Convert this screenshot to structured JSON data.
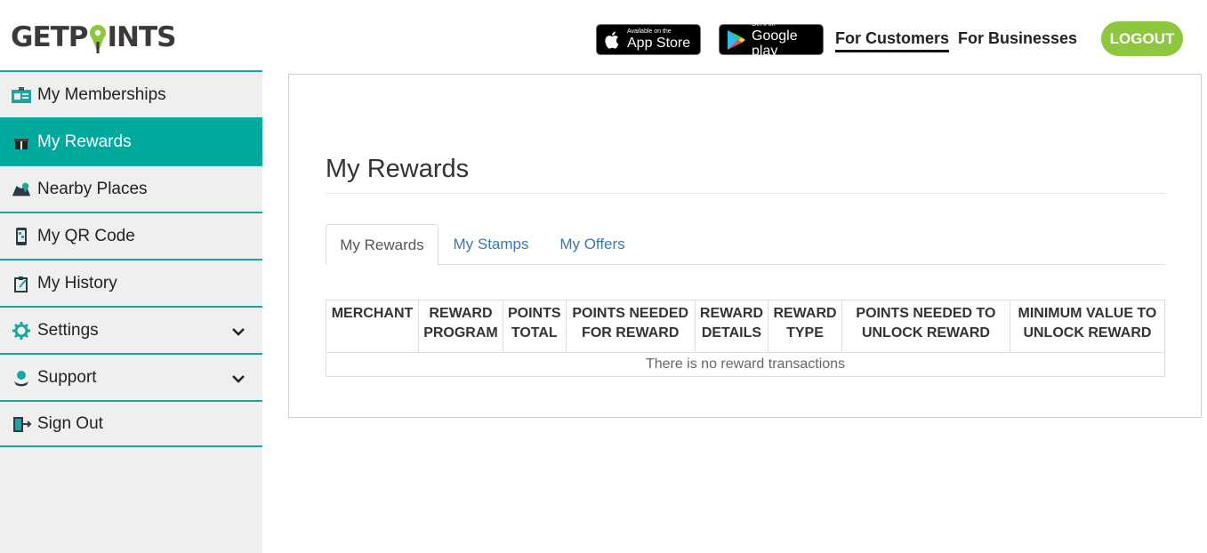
{
  "brand": {
    "logo_text_before": "GETP",
    "logo_text_after": "INTS",
    "logo_pin_color": "#8dc63f"
  },
  "header": {
    "app_store": {
      "small": "Available on the",
      "big": "App Store",
      "icon": "apple-icon"
    },
    "google_play": {
      "small": "Get it on",
      "big": "Google play",
      "icon": "google-play-icon"
    },
    "nav": {
      "customers": "For Customers",
      "businesses": "For Businesses"
    },
    "logout_label": "LOGOUT"
  },
  "colors": {
    "accent": "#00a99d",
    "logout": "#8dc63f",
    "link": "#3a78b4"
  },
  "sidebar": {
    "items": [
      {
        "label": "My Memberships",
        "icon": "membership-card-icon"
      },
      {
        "label": "My Rewards",
        "icon": "gift-icon",
        "active": true
      },
      {
        "label": "Nearby Places",
        "icon": "map-icon"
      },
      {
        "label": "My QR Code",
        "icon": "phone-qr-icon"
      },
      {
        "label": "My History",
        "icon": "clipboard-history-icon"
      },
      {
        "label": "Settings",
        "icon": "gear-icon",
        "expandable": true
      },
      {
        "label": "Support",
        "icon": "support-icon",
        "expandable": true
      },
      {
        "label": "Sign Out",
        "icon": "sign-out-icon"
      }
    ]
  },
  "main": {
    "title": "My Rewards",
    "tabs": [
      "My Rewards",
      "My Stamps",
      "My Offers"
    ],
    "table": {
      "headers": [
        "MERCHANT",
        "REWARD PROGRAM",
        "POINTS TOTAL",
        "POINTS NEEDED FOR REWARD",
        "REWARD DETAILS",
        "REWARD TYPE",
        "POINTS NEEDED TO UNLOCK REWARD",
        "MINIMUM VALUE TO UNLOCK REWARD"
      ],
      "empty_message": "There is no reward transactions"
    }
  }
}
